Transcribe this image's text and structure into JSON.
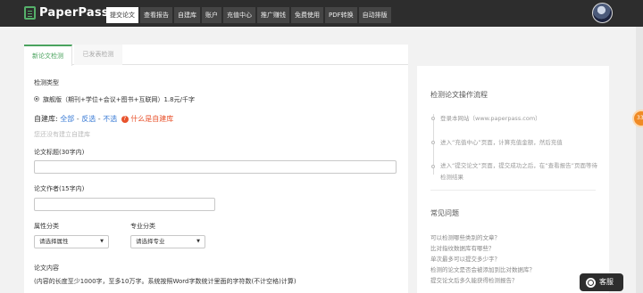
{
  "brand": {
    "name": "PaperPass"
  },
  "nav": {
    "items": [
      "提交论文",
      "查看报告",
      "自建库",
      "账户",
      "充值中心",
      "推广赚钱",
      "免费使用",
      "PDF转换",
      "自动排版"
    ],
    "active_index": 0
  },
  "tabs": {
    "new": "新论文检测",
    "submitted": "已发表检测"
  },
  "form": {
    "check_type_label": "检测类型",
    "check_type_option": "旗舰版（期刊+学位+会议+图书+互联网）1.8元/千字",
    "db_label": "自建库:",
    "db_all": "全部",
    "db_invert": "反选",
    "db_none": "不选",
    "db_sep": "-",
    "db_help_icon": "?",
    "db_help": "什么是自建库",
    "db_hint": "您还没有建立自建库",
    "title_label": "论文标题(30字内)",
    "author_label": "论文作者(15字内)",
    "attr_label": "属性分类",
    "attr_value": "请选择属性",
    "major_label": "专业分类",
    "major_value": "请选择专业",
    "content_label": "论文内容",
    "content_hint": "(内容的长度至少1000字，至多10万字。系统按照Word字数统计里面的字符数(不计空格)计算)"
  },
  "sidebar": {
    "flow_title": "检测论文操作流程",
    "steps": [
      "登录本网站（www.paperpass.com）",
      "进入“充值中心”页面，计算充值金额，然后充值",
      "进入“提交论文”页面，提交成功之后，在“查看报告”页面等待检测结果"
    ],
    "faq_title": "常见问题",
    "faqs": [
      "可以检测哪些类别的文章？",
      "比对指纹数据库有哪些？",
      "单次最多可以提交多少字？",
      "检测的论文是否会被添加到比对数据库？",
      "提交论文后多久能获得检测报告？"
    ]
  },
  "float_badge": "33",
  "support_button": "客服",
  "colors": {
    "accent": "#4aa35e",
    "link": "#3a7bd5",
    "warning": "#e8522c",
    "topbar": "#2d2d2d"
  }
}
